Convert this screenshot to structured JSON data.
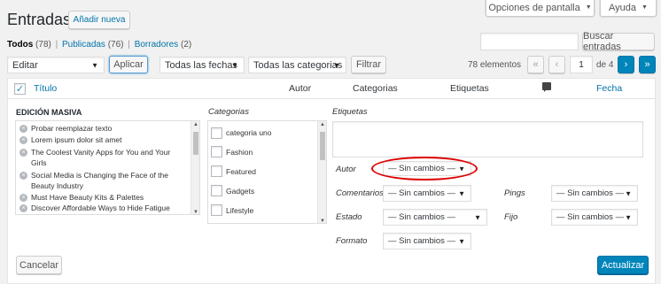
{
  "header": {
    "title": "Entradas",
    "add_new_label": "Añadir nueva",
    "screen_options_label": "Opciones de pantalla",
    "help_label": "Ayuda"
  },
  "filters": {
    "all_label": "Todos",
    "all_count": "(78)",
    "published_label": "Publicadas",
    "published_count": "(76)",
    "drafts_label": "Borradores",
    "drafts_count": "(2)",
    "sep1": "|",
    "sep2": "|"
  },
  "search": {
    "value": "",
    "button_label": "Buscar entradas"
  },
  "bulk": {
    "action_selected": "Editar",
    "apply_label": "Aplicar",
    "dates_selected": "Todas las fechas",
    "categories_selected": "Todas las categorias",
    "filter_label": "Filtrar"
  },
  "pagination": {
    "items_text": "78 elementos",
    "first": "«",
    "prev": "‹",
    "current_page": "1",
    "of_text": "de 4",
    "next": "›",
    "last": "»"
  },
  "table_headers": {
    "title": "Título",
    "author": "Autor",
    "categories": "Categorias",
    "tags": "Etiquetas",
    "date": "Fecha"
  },
  "bulk_edit": {
    "heading": "EDICIÓN MASIVA",
    "titles": [
      "Probar reemplazar texto",
      "Lorem ipsum dolor sit amet",
      "The Coolest Vanity Apps for You and Your",
      "Girls",
      "Social Media is Changing the Face of the",
      "Beauty Industry",
      "Must Have Beauty Kits & Palettes",
      "Discover Affordable Ways to Hide Fatigue"
    ],
    "categories_label": "Categorias",
    "categories": [
      "categoria uno",
      "Fashion",
      "Featured",
      "Gadgets",
      "Lifestyle"
    ],
    "tags_label": "Etiquetas",
    "tags_value": "",
    "author_label": "Autor",
    "author_value": "— Sin cambios —",
    "comments_label": "Comentarios",
    "comments_value": "— Sin cambios —",
    "pings_label": "Pings",
    "pings_value": "— Sin cambios —",
    "status_label": "Estado",
    "status_value": "— Sin cambios —",
    "sticky_label": "Fijo",
    "sticky_value": "— Sin cambios —",
    "format_label": "Formato",
    "format_value": "— Sin cambios —",
    "cancel_label": "Cancelar",
    "update_label": "Actualizar"
  },
  "colors": {
    "link": "#0073aa",
    "primary": "#0085ba",
    "highlight_circle": "#dd0000"
  }
}
